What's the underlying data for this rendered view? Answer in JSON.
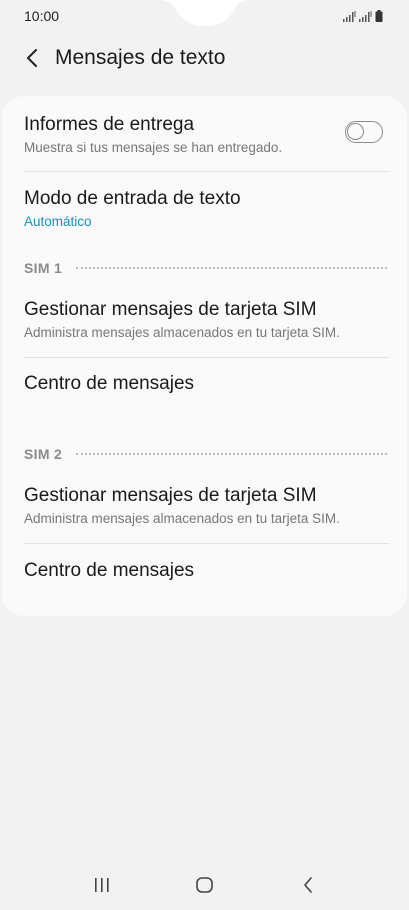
{
  "status_bar": {
    "time": "10:00",
    "icons": [
      "signal-sim1-icon",
      "signal-sim2-icon",
      "battery-icon"
    ]
  },
  "header": {
    "back_icon": "chevron-left-icon",
    "title": "Mensajes de texto"
  },
  "settings": {
    "delivery_reports": {
      "title": "Informes de entrega",
      "subtitle": "Muestra si tus mensajes se han entregado.",
      "toggle_on": false
    },
    "input_mode": {
      "title": "Modo de entrada de texto",
      "value": "Automático"
    },
    "sim1": {
      "label": "SIM 1",
      "manage_title": "Gestionar mensajes de tarjeta SIM",
      "manage_subtitle": "Administra mensajes almacenados en tu tarjeta SIM.",
      "center_title": "Centro de mensajes"
    },
    "sim2": {
      "label": "SIM 2",
      "manage_title": "Gestionar mensajes de tarjeta SIM",
      "manage_subtitle": "Administra mensajes almacenados en tu tarjeta SIM.",
      "center_title": "Centro de mensajes"
    }
  },
  "nav_bar": {
    "buttons": [
      "recent-apps-icon",
      "home-icon",
      "back-icon"
    ]
  },
  "colors": {
    "background": "#f2f2f2",
    "card": "#fafafa",
    "accent": "#1b8fb5"
  }
}
